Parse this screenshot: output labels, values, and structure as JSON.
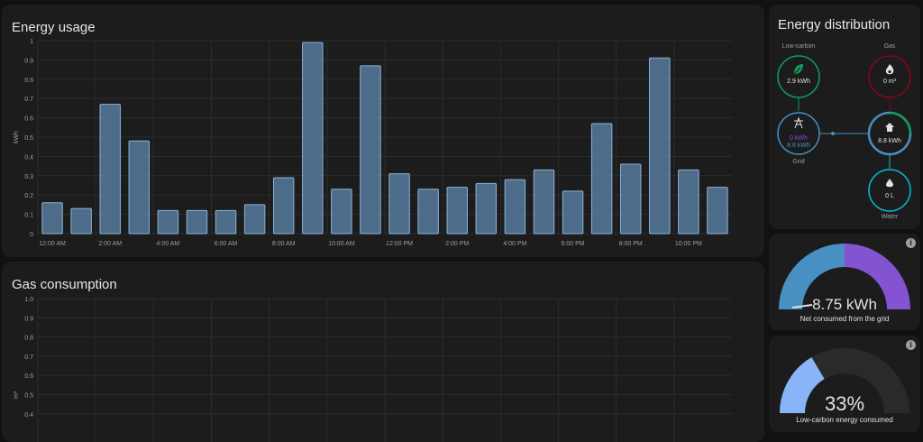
{
  "energy_usage": {
    "title": "Energy usage",
    "y_unit": "kWh",
    "y_ticks": [
      "0",
      "0.1",
      "0.2",
      "0.3",
      "0.4",
      "0.5",
      "0.6",
      "0.7",
      "0.8",
      "0.9",
      "1"
    ],
    "x_ticks": [
      "12:00 AM",
      "2:00 AM",
      "4:00 AM",
      "6:00 AM",
      "8:00 AM",
      "10:00 AM",
      "12:00 PM",
      "2:00 PM",
      "4:00 PM",
      "6:00 PM",
      "8:00 PM",
      "10:00 PM"
    ]
  },
  "gas_consumption": {
    "title": "Gas consumption",
    "y_unit": "m³",
    "y_ticks": [
      "0.4",
      "0.5",
      "0.6",
      "0.7",
      "0.8",
      "0.9",
      "1.0"
    ]
  },
  "distribution": {
    "title": "Energy distribution",
    "low_carbon": {
      "label": "Low-carbon",
      "value": "2.9 kWh",
      "icon": "leaf-icon",
      "color": "#0f9d58"
    },
    "gas": {
      "label": "Gas",
      "value": "0 m³",
      "icon": "fire-icon",
      "color": "#8e021b"
    },
    "grid": {
      "label": "Grid",
      "return": "0 kWh",
      "consumed": "8.8 kWh",
      "icon": "transmission-tower-icon",
      "color": "#488fc2",
      "return_color": "#8353d1"
    },
    "home": {
      "value": "8.8 kWh",
      "icon": "home-icon"
    },
    "water": {
      "label": "Water",
      "value": "0 L",
      "icon": "water-drop-icon",
      "color": "#00bcd4"
    }
  },
  "grid_gauge": {
    "value": "8.75 kWh",
    "label": "Net consumed from the grid",
    "consumed_color": "#488fc2",
    "return_color": "#8353d1"
  },
  "low_carbon_gauge": {
    "value": "33%",
    "percent": 33,
    "label": "Low-carbon energy consumed",
    "color": "#8ab4f8",
    "track_color": "#2a2a2a"
  },
  "chart_data": [
    {
      "type": "bar",
      "title": "Energy usage",
      "ylabel": "kWh",
      "ylim": [
        0,
        1
      ],
      "x": [
        0,
        1,
        2,
        3,
        4,
        5,
        6,
        7,
        8,
        9,
        10,
        11,
        12,
        13,
        14,
        15,
        16,
        17,
        18,
        19,
        20,
        21,
        22,
        23
      ],
      "x_tick_labels": [
        "12:00 AM",
        "2:00 AM",
        "4:00 AM",
        "6:00 AM",
        "8:00 AM",
        "10:00 AM",
        "12:00 PM",
        "2:00 PM",
        "4:00 PM",
        "6:00 PM",
        "8:00 PM",
        "10:00 PM"
      ],
      "values": [
        0.16,
        0.13,
        0.67,
        0.48,
        0.12,
        0.12,
        0.12,
        0.15,
        0.29,
        0.99,
        0.23,
        0.87,
        0.31,
        0.23,
        0.24,
        0.26,
        0.28,
        0.33,
        0.22,
        0.57,
        0.36,
        0.91,
        0.33,
        0.24
      ],
      "color": "#5d87ad",
      "grid": true
    },
    {
      "type": "bar",
      "title": "Gas consumption",
      "ylabel": "m³",
      "y_visible_range": [
        0.3,
        1.0
      ],
      "values": [],
      "grid": true
    }
  ]
}
